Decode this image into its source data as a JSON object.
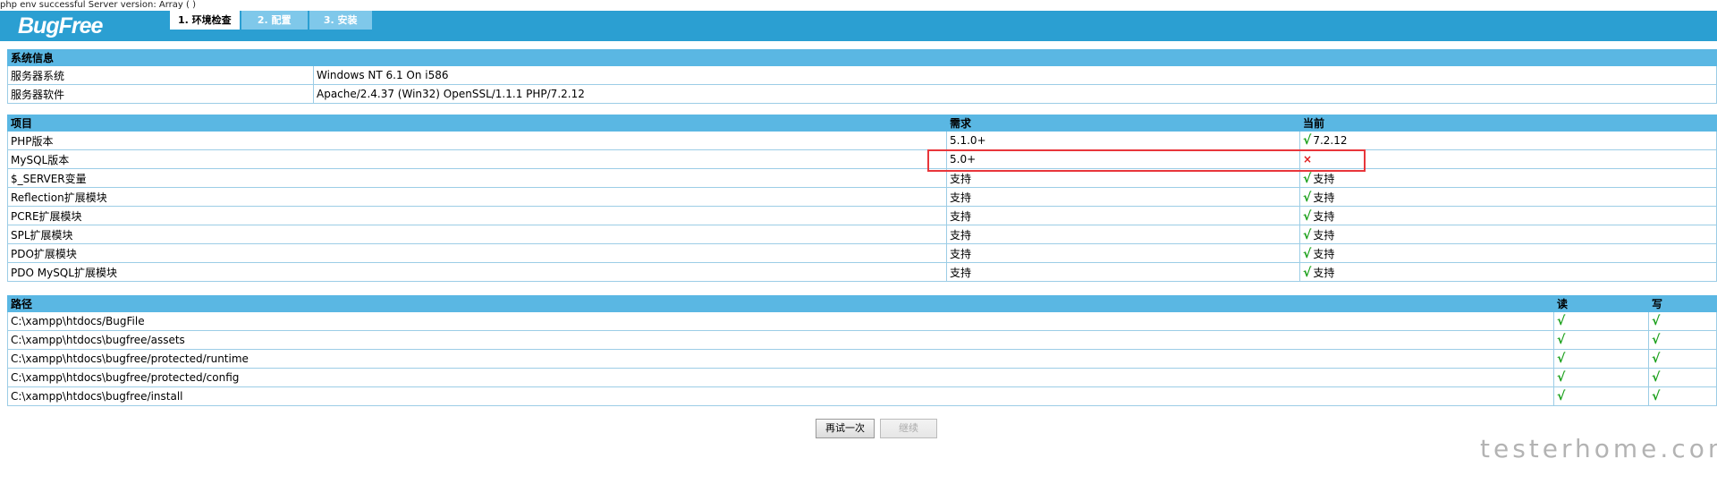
{
  "debug_text": "php env successful Server version: Array ( )",
  "logo_text": "BugFree",
  "tabs": [
    {
      "label": "1. 环境检查",
      "active": true
    },
    {
      "label": "2. 配置",
      "active": false
    },
    {
      "label": "3. 安装",
      "active": false
    }
  ],
  "system_info": {
    "title": "系统信息",
    "rows": [
      {
        "name": "服务器系统",
        "value": "Windows NT 6.1 On i586"
      },
      {
        "name": "服务器软件",
        "value": "Apache/2.4.37 (Win32) OpenSSL/1.1.1 PHP/7.2.12"
      }
    ]
  },
  "env_check": {
    "headers": {
      "item": "项目",
      "required": "需求",
      "current": "当前"
    },
    "rows": [
      {
        "item": "PHP版本",
        "required": "5.1.0+",
        "status": "ok",
        "current": "7.2.12"
      },
      {
        "item": "MySQL版本",
        "required": "5.0+",
        "status": "fail",
        "current": ""
      },
      {
        "item": "$_SERVER变量",
        "required": "支持",
        "status": "ok",
        "current": "支持"
      },
      {
        "item": "Reflection扩展模块",
        "required": "支持",
        "status": "ok",
        "current": "支持"
      },
      {
        "item": "PCRE扩展模块",
        "required": "支持",
        "status": "ok",
        "current": "支持"
      },
      {
        "item": "SPL扩展模块",
        "required": "支持",
        "status": "ok",
        "current": "支持"
      },
      {
        "item": "PDO扩展模块",
        "required": "支持",
        "status": "ok",
        "current": "支持"
      },
      {
        "item": "PDO MySQL扩展模块",
        "required": "支持",
        "status": "ok",
        "current": "支持"
      }
    ]
  },
  "paths": {
    "headers": {
      "path": "路径",
      "read": "读",
      "write": "写"
    },
    "rows": [
      {
        "path": "C:\\xampp\\htdocs/BugFile",
        "read": "ok",
        "write": "ok"
      },
      {
        "path": "C:\\xampp\\htdocs\\bugfree/assets",
        "read": "ok",
        "write": "ok"
      },
      {
        "path": "C:\\xampp\\htdocs\\bugfree/protected/runtime",
        "read": "ok",
        "write": "ok"
      },
      {
        "path": "C:\\xampp\\htdocs\\bugfree/protected/config",
        "read": "ok",
        "write": "ok"
      },
      {
        "path": "C:\\xampp\\htdocs\\bugfree/install",
        "read": "ok",
        "write": "ok"
      }
    ]
  },
  "icons": {
    "ok": "check-icon",
    "fail": "cross-icon"
  },
  "glyphs": {
    "ok": "√",
    "fail": "×"
  },
  "buttons": {
    "retry": "再试一次",
    "continue": "继续"
  },
  "watermark": "testerhome.com",
  "colors": {
    "header": "#2b9fd2",
    "table_head": "#5ab7e3",
    "ok": "#1aa01a",
    "fail": "#e01b1b",
    "highlight": "#e8363b"
  }
}
